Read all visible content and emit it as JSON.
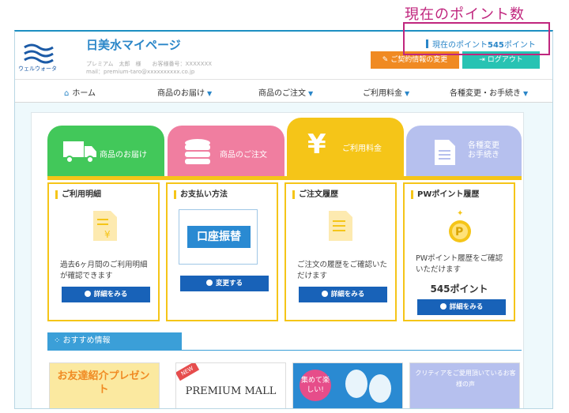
{
  "annotation": {
    "label": "現在のポイント数"
  },
  "header": {
    "logo_text": "ウェルウォータ",
    "site_title": "日美水マイページ",
    "member_line": "プレミアム　太郎　様　　お客様番号：XXXXXXX",
    "mail_line": "mail：premium-taro@xxxxxxxxxx.co.jp",
    "points_prefix": "現在のポイント",
    "points_value": "545",
    "points_suffix": "ポイント",
    "contract_button": "ご契約情報の変更",
    "logout_button": "ログアウト"
  },
  "nav": {
    "items": [
      {
        "label": "ホーム"
      },
      {
        "label": "商品のお届け"
      },
      {
        "label": "商品のご注文"
      },
      {
        "label": "ご利用料金"
      },
      {
        "label": "各種変更・お手続き"
      }
    ]
  },
  "tabs": [
    {
      "label": "商品のお届け"
    },
    {
      "label": "商品のご注文"
    },
    {
      "label": "ご利用料金"
    },
    {
      "label": "各種変更\nお手続き"
    }
  ],
  "cards": [
    {
      "title": "ご利用明細",
      "desc": "過去6ヶ月間のご利用明細が確認できます",
      "button": "詳細をみる"
    },
    {
      "title": "お支払い方法",
      "bank_label": "口座振替",
      "button": "変更する"
    },
    {
      "title": "ご注文履歴",
      "desc": "ご注文の履歴をご確認いただけます",
      "button": "詳細をみる"
    },
    {
      "title": "PWポイント履歴",
      "desc": "PWポイント履歴をご確認いただけます",
      "points": "545ポイント",
      "button": "詳細をみる"
    }
  ],
  "recommend": {
    "heading": "おすすめ情報",
    "banners": [
      {
        "text": "お友達紹介プレゼント"
      },
      {
        "text": "PREMIUM MALL",
        "tag": "NEW"
      },
      {
        "text": "集めて楽しい!"
      },
      {
        "text": "クリティアをご愛用頂いているお客様の声"
      }
    ]
  }
}
